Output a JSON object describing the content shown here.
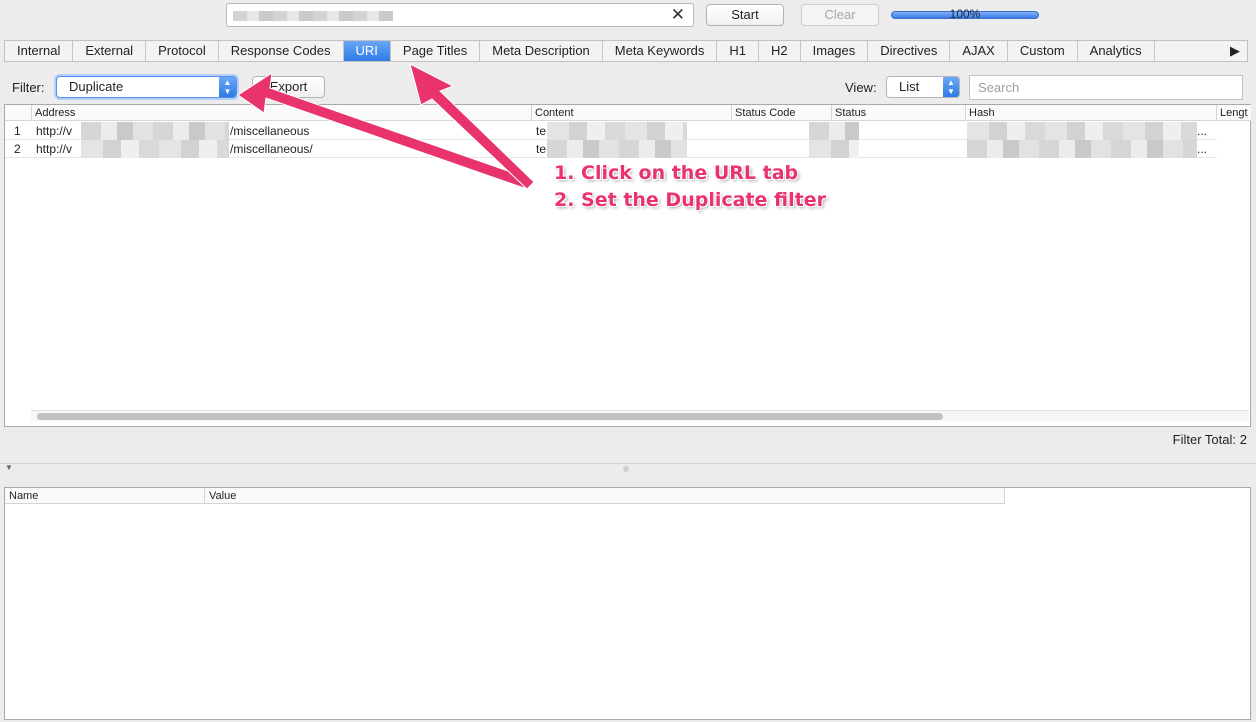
{
  "toolbar": {
    "url_value": "",
    "clear_x": "✕",
    "start_label": "Start",
    "clear_label": "Clear",
    "progress_text": "100%",
    "progress_value": 1.0
  },
  "tabs": [
    {
      "label": "Internal",
      "active": false
    },
    {
      "label": "External",
      "active": false
    },
    {
      "label": "Protocol",
      "active": false
    },
    {
      "label": "Response Codes",
      "active": false
    },
    {
      "label": "URI",
      "active": true
    },
    {
      "label": "Page Titles",
      "active": false
    },
    {
      "label": "Meta Description",
      "active": false
    },
    {
      "label": "Meta Keywords",
      "active": false
    },
    {
      "label": "H1",
      "active": false
    },
    {
      "label": "H2",
      "active": false
    },
    {
      "label": "Images",
      "active": false
    },
    {
      "label": "Directives",
      "active": false
    },
    {
      "label": "AJAX",
      "active": false
    },
    {
      "label": "Custom",
      "active": false
    },
    {
      "label": "Analytics",
      "active": false
    }
  ],
  "tab_more": "▶",
  "filter": {
    "label": "Filter:",
    "selected": "Duplicate",
    "export_label": "Export",
    "view_label": "View:",
    "view_selected": "List",
    "search_placeholder": "Search"
  },
  "table": {
    "columns": {
      "address": "Address",
      "content": "Content",
      "status_code": "Status Code",
      "status": "Status",
      "hash": "Hash",
      "length": "Lengt"
    },
    "rows": [
      {
        "num": "1",
        "address_prefix": "http://v",
        "address_suffix": "/miscellaneous",
        "content_prefix": "te",
        "hash_suffix": "..."
      },
      {
        "num": "2",
        "address_prefix": "http://v",
        "address_suffix": "/miscellaneous/",
        "content_prefix": "te",
        "hash_suffix": "..."
      }
    ],
    "filter_total_label": "Filter Total:",
    "filter_total_value": "2"
  },
  "details": {
    "columns": {
      "name": "Name",
      "value": "Value"
    }
  },
  "annotation": {
    "line1": "1. Click on the URL tab",
    "line2": "2. Set the Duplicate filter",
    "color": "#e8336d"
  },
  "colors": {
    "accent_blue": "#2f7ae7",
    "annotation_pink": "#e8336d"
  }
}
